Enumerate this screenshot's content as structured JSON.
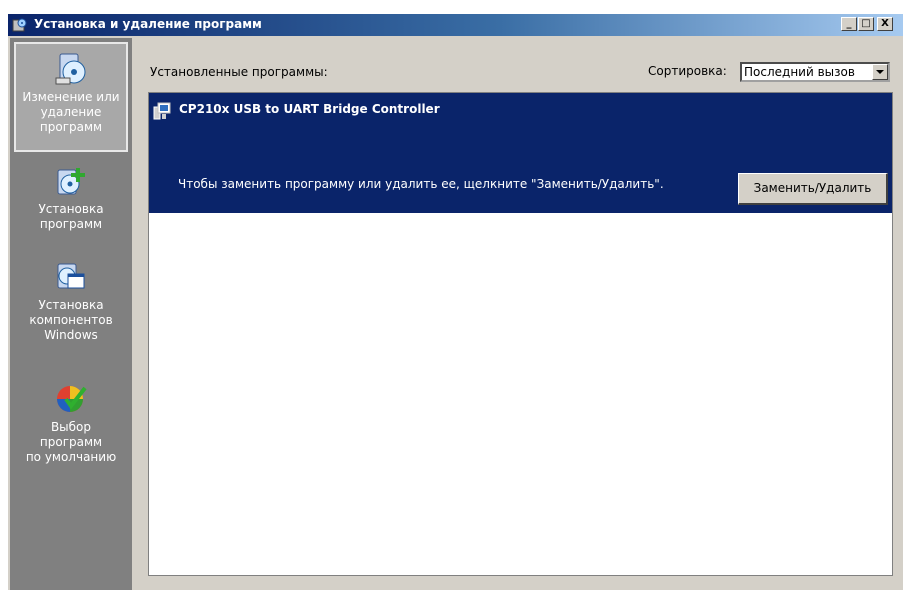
{
  "window": {
    "title": "Установка и удаление программ",
    "min_label": "_",
    "max_label": "□",
    "close_label": "X"
  },
  "sidebar": {
    "items": [
      {
        "label": "Изменение или\nудаление\nпрограмм",
        "icon": "change-remove-programs-icon",
        "selected": true
      },
      {
        "label": "Установка\nпрограмм",
        "icon": "add-programs-icon",
        "selected": false
      },
      {
        "label": "Установка\nкомпонентов\nWindows",
        "icon": "windows-components-icon",
        "selected": false
      },
      {
        "label": "Выбор\nпрограмм\nпо умолчанию",
        "icon": "default-programs-icon",
        "selected": false
      }
    ]
  },
  "main": {
    "installed_label": "Установленные программы:",
    "sort_label": "Сортировка:",
    "sort_value": "Последний вызов",
    "programs": [
      {
        "name": "CP210x USB to UART Bridge Controller",
        "hint": "Чтобы заменить программу или удалить  ее, щелкните \"Заменить/Удалить\".",
        "button": "Заменить/Удалить",
        "selected": true
      }
    ]
  },
  "colors": {
    "selection": "#0a246a",
    "sidebar_bg": "#808080",
    "face": "#d4d0c8"
  }
}
